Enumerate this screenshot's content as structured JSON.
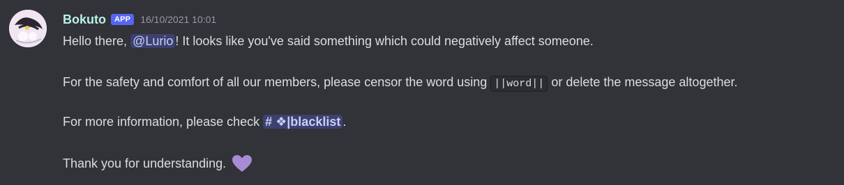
{
  "message": {
    "username": "Bokuto",
    "badge": "APP",
    "timestamp": "16/10/2021 10:01",
    "line1": {
      "before": "Hello there, ",
      "mention": "@Lurio",
      "after": "! It looks like you've said something which could negatively affect someone."
    },
    "line2": {
      "before": "For the safety and comfort of all our members, please censor the word using ",
      "code": "||word||",
      "after": " or delete the message altogether."
    },
    "line3": {
      "before": "For more information, please check ",
      "channel": "# ❖|blacklist",
      "after": "."
    },
    "line4": {
      "text": "Thank you for understanding.",
      "emoji": "purple-heart"
    }
  },
  "colors": {
    "background": "#313338",
    "text": "#dbdee1",
    "username": "#b9f0e7",
    "badge": "#5865f2",
    "timestamp": "#949ba4",
    "mention_bg": "#3c4270",
    "mention_text": "#c9cdfb",
    "heart": "#a78bd4"
  }
}
